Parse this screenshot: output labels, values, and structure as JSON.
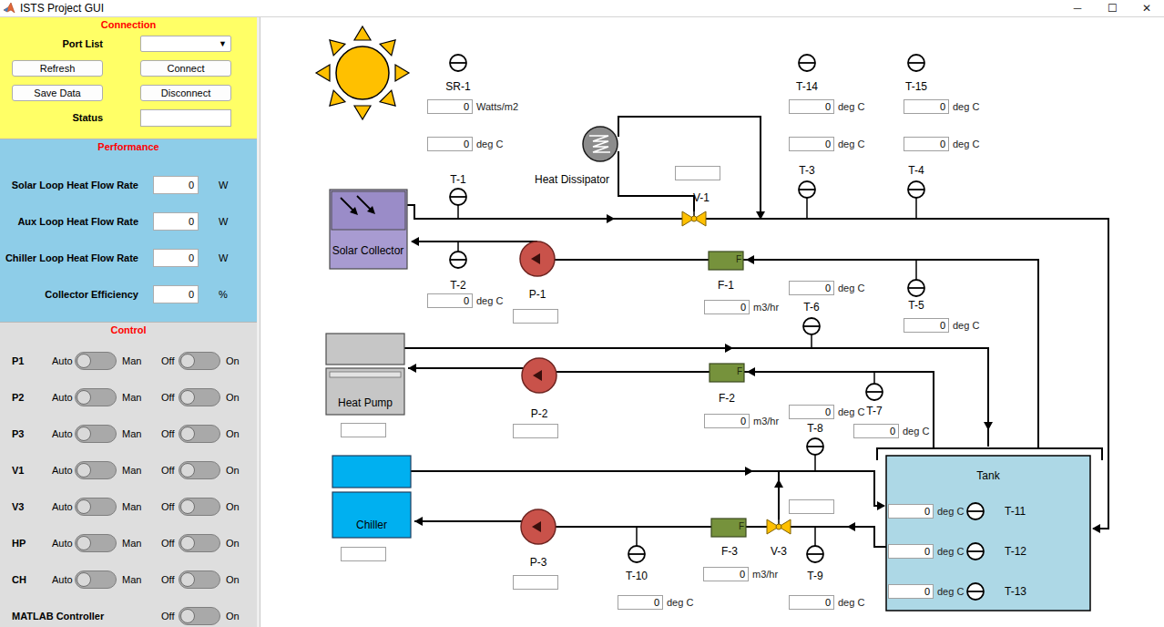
{
  "window": {
    "title": "ISTS Project GUI",
    "controls": [
      "─",
      "☐",
      "✕"
    ]
  },
  "connection": {
    "title": "Connection",
    "port_list": {
      "label": "Port List",
      "value": "",
      "arrow": "▼"
    },
    "buttons": [
      "Refresh",
      "Connect",
      "Save Data",
      "Disconnect"
    ],
    "status": {
      "label": "Status",
      "value": ""
    }
  },
  "performance": {
    "title": "Performance",
    "rows": [
      {
        "label": "Solar Loop Heat Flow Rate",
        "value": "0",
        "unit": "W"
      },
      {
        "label": "Aux Loop Heat Flow Rate",
        "value": "0",
        "unit": "W"
      },
      {
        "label": "Chiller Loop Heat Flow Rate",
        "value": "0",
        "unit": "W"
      },
      {
        "label": "Collector Efficiency",
        "value": "0",
        "unit": "%"
      }
    ]
  },
  "control": {
    "title": "Control",
    "rows": [
      {
        "kind": "mode",
        "label": "P1",
        "auto": "Auto",
        "man": "Man",
        "manual": false,
        "off": "Off",
        "on_text": "On",
        "on": false
      },
      {
        "kind": "mode",
        "label": "P2",
        "auto": "Auto",
        "man": "Man",
        "manual": false,
        "off": "Off",
        "on_text": "On",
        "on": false
      },
      {
        "kind": "mode",
        "label": "P3",
        "auto": "Auto",
        "man": "Man",
        "manual": false,
        "off": "Off",
        "on_text": "On",
        "on": false
      },
      {
        "kind": "mode",
        "label": "V1",
        "auto": "Auto",
        "man": "Man",
        "manual": false,
        "off": "Off",
        "on_text": "On",
        "on": false
      },
      {
        "kind": "mode",
        "label": "V3",
        "auto": "Auto",
        "man": "Man",
        "manual": false,
        "off": "Off",
        "on_text": "On",
        "on": false
      },
      {
        "kind": "mode",
        "label": "HP",
        "auto": "Auto",
        "man": "Man",
        "manual": false,
        "off": "Off",
        "on_text": "On",
        "on": false
      },
      {
        "kind": "mode",
        "label": "CH",
        "auto": "Auto",
        "man": "Man",
        "manual": false,
        "off": "Off",
        "on_text": "On",
        "on": false
      },
      {
        "kind": "power",
        "label": "MATLAB Controller",
        "off": "Off",
        "on_text": "On",
        "on": false
      }
    ]
  },
  "diagram": {
    "sensors": [
      {
        "label": "SR-1",
        "value": "0",
        "unit": "Watts/m2"
      },
      {
        "label": "T-14",
        "value": "0",
        "unit": "deg C"
      },
      {
        "label": "T-15",
        "value": "0",
        "unit": "deg C"
      },
      {
        "label": "T-1"
      },
      {
        "label": "T-2",
        "value": "0",
        "unit": "deg C"
      },
      {
        "label": "T-3"
      },
      {
        "label": "T-4"
      },
      {
        "label": "T-5",
        "value": "0",
        "unit": "deg C"
      },
      {
        "label": "T-6"
      },
      {
        "label": "T-7",
        "value": "0",
        "unit": "deg C"
      },
      {
        "label": "T-8"
      },
      {
        "label": "T-9",
        "value": "0",
        "unit": "deg C"
      },
      {
        "label": "T-10",
        "value": "0",
        "unit": "deg C"
      },
      {
        "label": "T-11",
        "value": "0",
        "unit": "deg C"
      },
      {
        "label": "T-12",
        "value": "0",
        "unit": "deg C"
      },
      {
        "label": "T-13",
        "value": "0",
        "unit": "deg C"
      }
    ],
    "readings": [
      {
        "value": "0",
        "unit": "deg C"
      },
      {
        "value": "0",
        "unit": "deg C"
      },
      {
        "value": "0",
        "unit": "deg C"
      },
      {
        "value": "0",
        "unit": "deg C"
      },
      {
        "value": "0",
        "unit": "deg C"
      }
    ],
    "solar_collector": {
      "label": "Solar Collector"
    },
    "heat_dissipator": {
      "label": "Heat Dissipator"
    },
    "heat_pump": {
      "label": "Heat Pump",
      "status": ""
    },
    "chiller": {
      "label": "Chiller",
      "status": ""
    },
    "tank": {
      "label": "Tank"
    },
    "pumps": [
      {
        "label": "P-1",
        "status": ""
      },
      {
        "label": "P-2",
        "status": ""
      },
      {
        "label": "P-3",
        "status": ""
      }
    ],
    "flow_meters": [
      {
        "label": "F-1",
        "mark": "F",
        "value": "0",
        "unit": "m3/hr"
      },
      {
        "label": "F-2",
        "mark": "F",
        "value": "0",
        "unit": "m3/hr"
      },
      {
        "label": "F-3",
        "mark": "F",
        "value": "0",
        "unit": "m3/hr"
      }
    ],
    "valves": [
      {
        "label": "V-1",
        "status": ""
      },
      {
        "label": "V-3",
        "status": ""
      }
    ]
  }
}
